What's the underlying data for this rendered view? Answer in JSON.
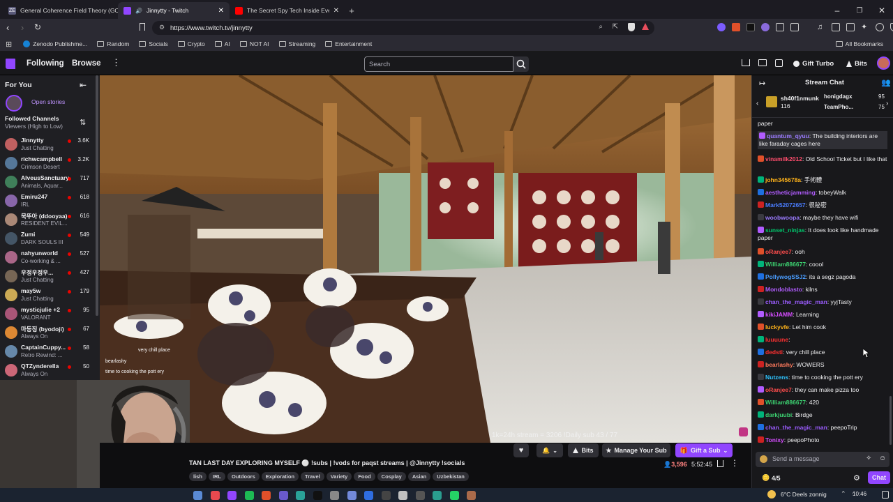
{
  "browser": {
    "tabs": [
      {
        "title": "General Coherence Field Theory (GC",
        "fav_color": "#5a5a7a",
        "fav_text": "ZE"
      },
      {
        "title": "Jinnytty - Twitch",
        "fav_color": "#9146ff",
        "fav_text": ""
      },
      {
        "title": "The Secret Spy Tech Inside Every Cre",
        "fav_color": "#ff0000",
        "fav_text": ""
      }
    ],
    "url": "https://www.twitch.tv/jinnytty",
    "bookmarks": [
      "Zenodo Publishme...",
      "Random",
      "Socials",
      "Crypto",
      "AI",
      "NOT AI",
      "Streaming",
      "Entertainment"
    ],
    "all_bookmarks": "All Bookmarks"
  },
  "twitch": {
    "nav": {
      "following": "Following",
      "browse": "Browse",
      "search_placeholder": "Search",
      "gift_turbo": "Gift Turbo",
      "bits": "Bits"
    },
    "sidebar": {
      "for_you": "For You",
      "open_stories": "Open stories",
      "followed_title": "Followed Channels",
      "followed_sort": "Viewers (High to Low)",
      "channels": [
        {
          "name": "Jinnytty",
          "game": "Just Chatting",
          "viewers": "3.6K",
          "color": "#c06060"
        },
        {
          "name": "richwcampbell",
          "game": "Crimson Desert",
          "viewers": "3.2K",
          "color": "#557799"
        },
        {
          "name": "AlveusSanctuary",
          "game": "Animals, Aquar...",
          "viewers": "717",
          "color": "#3f7f5a"
        },
        {
          "name": "Emiru247",
          "game": "IRL",
          "viewers": "618",
          "color": "#8866aa"
        },
        {
          "name": "묵뚜아 (ddooyaa)",
          "game": "RESIDENT EVIL...",
          "viewers": "616",
          "color": "#aa8877"
        },
        {
          "name": "Zumi",
          "game": "DARK SOULS III",
          "viewers": "549",
          "color": "#445566"
        },
        {
          "name": "nahyunworld",
          "game": "Co-working & ...",
          "viewers": "527",
          "color": "#aa6688"
        },
        {
          "name": "우정우정우...",
          "game": "Just Chatting",
          "viewers": "427",
          "color": "#776655"
        },
        {
          "name": "may5w",
          "game": "Just Chatting",
          "viewers": "179",
          "color": "#ccaa55"
        },
        {
          "name": "mysticjulie +2",
          "game": "VALORANT",
          "viewers": "95",
          "color": "#aa5577"
        },
        {
          "name": "마등징 (byodoji)",
          "game": "Always On",
          "viewers": "67",
          "color": "#dd8833"
        },
        {
          "name": "CaptainCuppy...",
          "game": "Retro Rewind: ...",
          "viewers": "58",
          "color": "#6688aa"
        },
        {
          "name": "QTZynderella",
          "game": "Always On",
          "viewers": "50",
          "color": "#cc6677"
        }
      ]
    },
    "video": {
      "overlay_text": "1k=24h stream = 3206  !Daily sub 43 / 77",
      "overlay_chat": [
        "very chill place",
        "bearlashy",
        "time to cooking the pott ery"
      ]
    },
    "stream": {
      "title": "TAN LAST DAY EXPLORING MYSELF ⚪ !subs | !vods for paqst streams | @Jinnytty !socials",
      "tags": [
        "lish",
        "IRL",
        "Outdoors",
        "Exploration",
        "Travel",
        "Variety",
        "Food",
        "Cosplay",
        "Asian",
        "Uzbekistan"
      ],
      "viewers": "3,596",
      "uptime": "5:52:45",
      "bits_label": "Bits",
      "manage_sub": "Manage Your Sub",
      "gift_sub": "Gift a Sub"
    },
    "chat": {
      "title": "Stream Chat",
      "leaderboard": {
        "first_name": "sh40f1nmunk",
        "first_val": "116",
        "second_name": "honigdagx",
        "second_val": "95",
        "third_name": "TeamPho...",
        "third_val": "75"
      },
      "messages": [
        {
          "user": "",
          "text": "paper",
          "color": "#efeff1"
        },
        {
          "user": "quantum_qyuu",
          "text": ": The building interiors are like faraday cages here",
          "color": "#9b7bff"
        },
        {
          "user": "vinamilk2012",
          "text": ": Old School Ticket but I like that",
          "color": "#ff4d6d"
        },
        {
          "user": "john345678a",
          "text": ": 手術體",
          "color": "#ffb31a"
        },
        {
          "user": "aestheticjamming",
          "text": ": tobeyWalk",
          "color": "#b15cff"
        },
        {
          "user": "Mark52072657",
          "text": ": 很秘密",
          "color": "#4a7dff"
        },
        {
          "user": "woobwoopa",
          "text": ": maybe they have wifi",
          "color": "#9b7bff"
        },
        {
          "user": "sunset_ninjas",
          "text": ": It does look like handmade paper",
          "color": "#00c46b"
        },
        {
          "user": "oRanjee7",
          "text": ": ooh",
          "color": "#ff4d4d"
        },
        {
          "user": "William886677",
          "text": ": coool",
          "color": "#3cd070"
        },
        {
          "user": "PollywogSSJ2",
          "text": ": its a segz pagoda",
          "color": "#4a9dff"
        },
        {
          "user": "Mondoblasto",
          "text": ": kilns",
          "color": "#b15cff"
        },
        {
          "user": "chan_the_magic_man",
          "text": ": yyjTasty",
          "color": "#9b5cff"
        },
        {
          "user": "kikiJAMM",
          "text": ": Learning",
          "color": "#d54dff"
        },
        {
          "user": "luckyvfe",
          "text": ": Let him cook",
          "color": "#ffb31a"
        },
        {
          "user": "luuuune",
          "text": ":",
          "color": "#ff3030"
        },
        {
          "user": "dedsti",
          "text": ": very chill place",
          "color": "#ff3030"
        },
        {
          "user": "bearlashy",
          "text": ": WOWERS",
          "color": "#ff7a5c"
        },
        {
          "user": "Nutzens",
          "text": ": time to cooking the pott ery",
          "color": "#2ec4ff"
        },
        {
          "user": "oRanjee7",
          "text": ": they can make pizza too",
          "color": "#ff4d4d"
        },
        {
          "user": "William886677",
          "text": ": 420",
          "color": "#3cd070"
        },
        {
          "user": "darkjuubi",
          "text": ": Birdge",
          "color": "#3cd070"
        },
        {
          "user": "chan_the_magic_man",
          "text": ": peepoTrip",
          "color": "#9b5cff"
        },
        {
          "user": "Tonixy",
          "text": ": peepoPhoto",
          "color": "#d54dff"
        }
      ],
      "input_placeholder": "Send a message",
      "points": "4/5",
      "chat_button": "Chat"
    }
  },
  "taskbar": {
    "weather": "6°C  Deels zonnig",
    "time": "10:46"
  },
  "colors": {
    "twitch_purple": "#9146ff",
    "live_red": "#eb0400"
  }
}
